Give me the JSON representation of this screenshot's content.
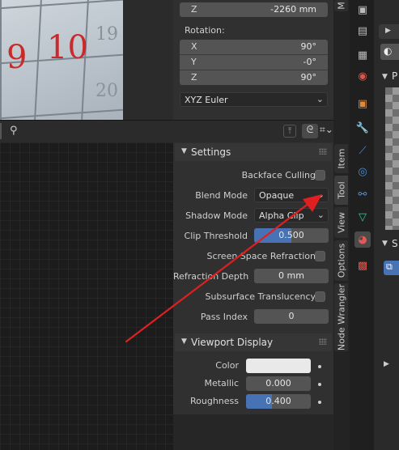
{
  "viewport": {
    "calendar_numbers": [
      "9",
      "10",
      "19",
      "20"
    ]
  },
  "transform": {
    "location_z": {
      "axis": "Z",
      "value": "-2260 mm"
    },
    "rotation_label": "Rotation:",
    "rotation": [
      {
        "axis": "X",
        "value": "90°"
      },
      {
        "axis": "Y",
        "value": "-0°"
      },
      {
        "axis": "Z",
        "value": "90°"
      }
    ],
    "rotation_mode": "XYZ Euler"
  },
  "side_tabs": {
    "top": "M",
    "item": "Item",
    "tool": "Tool",
    "view": "View",
    "options": "Options",
    "node_wrangler": "Node Wrangler"
  },
  "settings": {
    "title": "Settings",
    "backface_culling": {
      "label": "Backface Culling",
      "checked": false
    },
    "blend_mode": {
      "label": "Blend Mode",
      "value": "Opaque"
    },
    "shadow_mode": {
      "label": "Shadow Mode",
      "value": "Alpha Clip"
    },
    "clip_threshold": {
      "label": "Clip Threshold",
      "value": "0.500",
      "fraction": 0.5
    },
    "screen_space_refraction": {
      "label": "Screen Space Refraction",
      "checked": false
    },
    "refraction_depth": {
      "label": "Refraction Depth",
      "value": "0 mm"
    },
    "subsurface_translucency": {
      "label": "Subsurface Translucency",
      "checked": false
    },
    "pass_index": {
      "label": "Pass Index",
      "value": "0"
    }
  },
  "viewport_display": {
    "title": "Viewport Display",
    "color": {
      "label": "Color",
      "hex": "#e9e9e9"
    },
    "metallic": {
      "label": "Metallic",
      "value": "0.000",
      "fraction": 0.0
    },
    "roughness": {
      "label": "Roughness",
      "value": "0.400",
      "fraction": 0.4
    }
  },
  "properties_partial": {
    "header_letter": "P",
    "section_letter": "S"
  },
  "colors": {
    "accent_blue": "#4772b3",
    "annotation_arrow": "#e02020"
  }
}
